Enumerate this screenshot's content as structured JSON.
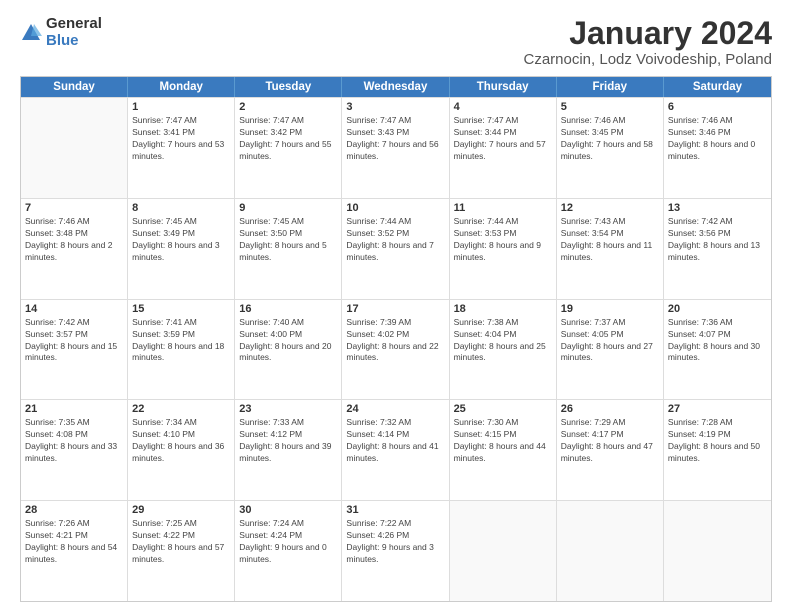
{
  "logo": {
    "general": "General",
    "blue": "Blue"
  },
  "title": "January 2024",
  "subtitle": "Czarnocin, Lodz Voivodeship, Poland",
  "calendar": {
    "headers": [
      "Sunday",
      "Monday",
      "Tuesday",
      "Wednesday",
      "Thursday",
      "Friday",
      "Saturday"
    ],
    "rows": [
      [
        {
          "day": "",
          "sunrise": "",
          "sunset": "",
          "daylight": ""
        },
        {
          "day": "1",
          "sunrise": "Sunrise: 7:47 AM",
          "sunset": "Sunset: 3:41 PM",
          "daylight": "Daylight: 7 hours and 53 minutes."
        },
        {
          "day": "2",
          "sunrise": "Sunrise: 7:47 AM",
          "sunset": "Sunset: 3:42 PM",
          "daylight": "Daylight: 7 hours and 55 minutes."
        },
        {
          "day": "3",
          "sunrise": "Sunrise: 7:47 AM",
          "sunset": "Sunset: 3:43 PM",
          "daylight": "Daylight: 7 hours and 56 minutes."
        },
        {
          "day": "4",
          "sunrise": "Sunrise: 7:47 AM",
          "sunset": "Sunset: 3:44 PM",
          "daylight": "Daylight: 7 hours and 57 minutes."
        },
        {
          "day": "5",
          "sunrise": "Sunrise: 7:46 AM",
          "sunset": "Sunset: 3:45 PM",
          "daylight": "Daylight: 7 hours and 58 minutes."
        },
        {
          "day": "6",
          "sunrise": "Sunrise: 7:46 AM",
          "sunset": "Sunset: 3:46 PM",
          "daylight": "Daylight: 8 hours and 0 minutes."
        }
      ],
      [
        {
          "day": "7",
          "sunrise": "Sunrise: 7:46 AM",
          "sunset": "Sunset: 3:48 PM",
          "daylight": "Daylight: 8 hours and 2 minutes."
        },
        {
          "day": "8",
          "sunrise": "Sunrise: 7:45 AM",
          "sunset": "Sunset: 3:49 PM",
          "daylight": "Daylight: 8 hours and 3 minutes."
        },
        {
          "day": "9",
          "sunrise": "Sunrise: 7:45 AM",
          "sunset": "Sunset: 3:50 PM",
          "daylight": "Daylight: 8 hours and 5 minutes."
        },
        {
          "day": "10",
          "sunrise": "Sunrise: 7:44 AM",
          "sunset": "Sunset: 3:52 PM",
          "daylight": "Daylight: 8 hours and 7 minutes."
        },
        {
          "day": "11",
          "sunrise": "Sunrise: 7:44 AM",
          "sunset": "Sunset: 3:53 PM",
          "daylight": "Daylight: 8 hours and 9 minutes."
        },
        {
          "day": "12",
          "sunrise": "Sunrise: 7:43 AM",
          "sunset": "Sunset: 3:54 PM",
          "daylight": "Daylight: 8 hours and 11 minutes."
        },
        {
          "day": "13",
          "sunrise": "Sunrise: 7:42 AM",
          "sunset": "Sunset: 3:56 PM",
          "daylight": "Daylight: 8 hours and 13 minutes."
        }
      ],
      [
        {
          "day": "14",
          "sunrise": "Sunrise: 7:42 AM",
          "sunset": "Sunset: 3:57 PM",
          "daylight": "Daylight: 8 hours and 15 minutes."
        },
        {
          "day": "15",
          "sunrise": "Sunrise: 7:41 AM",
          "sunset": "Sunset: 3:59 PM",
          "daylight": "Daylight: 8 hours and 18 minutes."
        },
        {
          "day": "16",
          "sunrise": "Sunrise: 7:40 AM",
          "sunset": "Sunset: 4:00 PM",
          "daylight": "Daylight: 8 hours and 20 minutes."
        },
        {
          "day": "17",
          "sunrise": "Sunrise: 7:39 AM",
          "sunset": "Sunset: 4:02 PM",
          "daylight": "Daylight: 8 hours and 22 minutes."
        },
        {
          "day": "18",
          "sunrise": "Sunrise: 7:38 AM",
          "sunset": "Sunset: 4:04 PM",
          "daylight": "Daylight: 8 hours and 25 minutes."
        },
        {
          "day": "19",
          "sunrise": "Sunrise: 7:37 AM",
          "sunset": "Sunset: 4:05 PM",
          "daylight": "Daylight: 8 hours and 27 minutes."
        },
        {
          "day": "20",
          "sunrise": "Sunrise: 7:36 AM",
          "sunset": "Sunset: 4:07 PM",
          "daylight": "Daylight: 8 hours and 30 minutes."
        }
      ],
      [
        {
          "day": "21",
          "sunrise": "Sunrise: 7:35 AM",
          "sunset": "Sunset: 4:08 PM",
          "daylight": "Daylight: 8 hours and 33 minutes."
        },
        {
          "day": "22",
          "sunrise": "Sunrise: 7:34 AM",
          "sunset": "Sunset: 4:10 PM",
          "daylight": "Daylight: 8 hours and 36 minutes."
        },
        {
          "day": "23",
          "sunrise": "Sunrise: 7:33 AM",
          "sunset": "Sunset: 4:12 PM",
          "daylight": "Daylight: 8 hours and 39 minutes."
        },
        {
          "day": "24",
          "sunrise": "Sunrise: 7:32 AM",
          "sunset": "Sunset: 4:14 PM",
          "daylight": "Daylight: 8 hours and 41 minutes."
        },
        {
          "day": "25",
          "sunrise": "Sunrise: 7:30 AM",
          "sunset": "Sunset: 4:15 PM",
          "daylight": "Daylight: 8 hours and 44 minutes."
        },
        {
          "day": "26",
          "sunrise": "Sunrise: 7:29 AM",
          "sunset": "Sunset: 4:17 PM",
          "daylight": "Daylight: 8 hours and 47 minutes."
        },
        {
          "day": "27",
          "sunrise": "Sunrise: 7:28 AM",
          "sunset": "Sunset: 4:19 PM",
          "daylight": "Daylight: 8 hours and 50 minutes."
        }
      ],
      [
        {
          "day": "28",
          "sunrise": "Sunrise: 7:26 AM",
          "sunset": "Sunset: 4:21 PM",
          "daylight": "Daylight: 8 hours and 54 minutes."
        },
        {
          "day": "29",
          "sunrise": "Sunrise: 7:25 AM",
          "sunset": "Sunset: 4:22 PM",
          "daylight": "Daylight: 8 hours and 57 minutes."
        },
        {
          "day": "30",
          "sunrise": "Sunrise: 7:24 AM",
          "sunset": "Sunset: 4:24 PM",
          "daylight": "Daylight: 9 hours and 0 minutes."
        },
        {
          "day": "31",
          "sunrise": "Sunrise: 7:22 AM",
          "sunset": "Sunset: 4:26 PM",
          "daylight": "Daylight: 9 hours and 3 minutes."
        },
        {
          "day": "",
          "sunrise": "",
          "sunset": "",
          "daylight": ""
        },
        {
          "day": "",
          "sunrise": "",
          "sunset": "",
          "daylight": ""
        },
        {
          "day": "",
          "sunrise": "",
          "sunset": "",
          "daylight": ""
        }
      ]
    ]
  }
}
